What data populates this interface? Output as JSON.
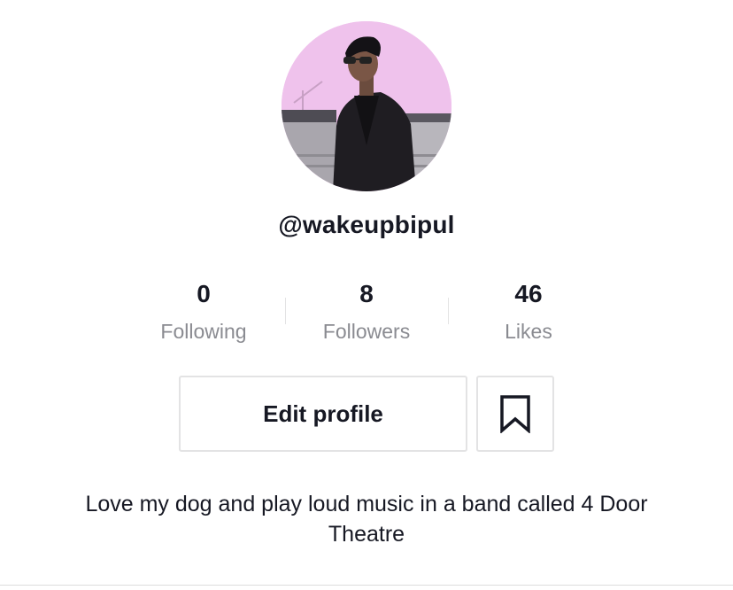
{
  "profile": {
    "username": "@wakeupbipul",
    "bio": "Love my dog and play loud music in a band called 4 Door Theatre"
  },
  "stats": [
    {
      "value": "0",
      "label": "Following"
    },
    {
      "value": "8",
      "label": "Followers"
    },
    {
      "value": "46",
      "label": "Likes"
    }
  ],
  "actions": {
    "edit_label": "Edit profile",
    "bookmark_icon": "bookmark-icon"
  },
  "colors": {
    "text_primary": "#161823",
    "text_secondary": "#8a8b91",
    "border": "#e3e3e4",
    "avatar_background": "#efc2ec"
  }
}
